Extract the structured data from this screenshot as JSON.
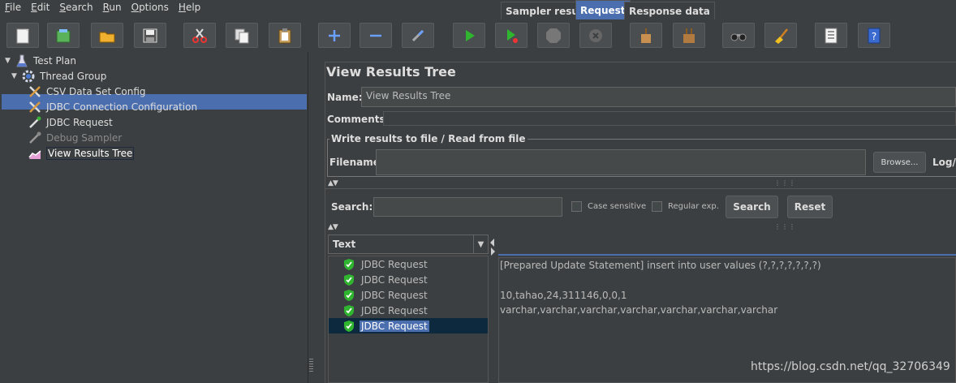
{
  "menu": [
    {
      "label": "File",
      "mnemonic": "F",
      "rest": "ile"
    },
    {
      "label": "Edit",
      "mnemonic": "E",
      "rest": "dit"
    },
    {
      "label": "Search",
      "mnemonic": "S",
      "rest": "earch"
    },
    {
      "label": "Run",
      "mnemonic": "R",
      "rest": "un"
    },
    {
      "label": "Options",
      "mnemonic": "O",
      "rest": "ptions"
    },
    {
      "label": "Help",
      "mnemonic": "H",
      "rest": "elp"
    }
  ],
  "toolbar_icons": [
    "new-icon",
    "templates-icon",
    "open-icon",
    "save-icon",
    "cut-icon",
    "copy-icon",
    "paste-icon",
    "expand-icon",
    "collapse-icon",
    "toggle-icon",
    "start-icon",
    "start-no-pause-icon",
    "stop-icon",
    "shutdown-icon",
    "clear-icon",
    "clear-all-icon",
    "search-icon",
    "reset-search-icon",
    "function-helper-icon",
    "help-icon"
  ],
  "tree": {
    "test_plan": "Test Plan",
    "thread_group": "Thread Group",
    "csv_config": "CSV Data Set Config",
    "jdbc_config": "JDBC Connection Configuration",
    "jdbc_request": "JDBC Request",
    "debug_sampler": "Debug Sampler",
    "view_results_tree": "View Results Tree"
  },
  "panel": {
    "title": "View Results Tree",
    "name_label": "Name:",
    "name_value": "View Results Tree",
    "comments_label": "Comments:",
    "group_title": "Write results to file / Read from file",
    "filename_label": "Filename",
    "browse_label": "Browse...",
    "logd_label": "Log/D"
  },
  "search": {
    "label": "Search:",
    "case_sensitive": "Case sensitive",
    "regular_exp": "Regular exp.",
    "search_button": "Search",
    "reset_button": "Reset"
  },
  "renderer": "Text",
  "results": [
    "JDBC Request",
    "JDBC Request",
    "JDBC Request",
    "JDBC Request",
    "JDBC Request"
  ],
  "tabs": [
    "Sampler result",
    "Request",
    "Response data"
  ],
  "request_text": [
    "[Prepared Update Statement] insert into user values (?,?,?,?,?,?,?)",
    "",
    "10,tahao,24,311146,0,0,1",
    "varchar,varchar,varchar,varchar,varchar,varchar,varchar"
  ],
  "watermark": "https://blog.csdn.net/qq_32706349",
  "colors": {
    "background": "#3c3f41",
    "selection": "#4b6eaf",
    "success": "#2fb52f"
  }
}
